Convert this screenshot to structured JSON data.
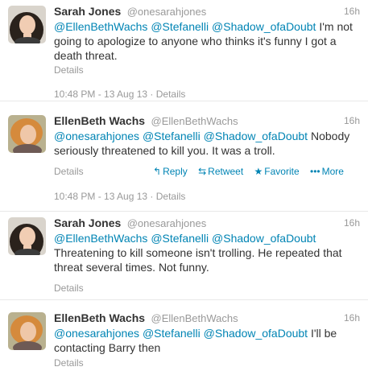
{
  "tweets": [
    {
      "fullname": "Sarah Jones",
      "handle": "@onesarahjones",
      "time": "16h",
      "mentions": [
        "@EllenBethWachs",
        "@Stefanelli",
        "@Shadow_ofaDoubt"
      ],
      "body": "I'm not going to apologize to anyone who thinks it's funny I got a death threat.",
      "details": "Details",
      "timestamp": "10:48 PM - 13 Aug 13 · Details"
    },
    {
      "fullname": "EllenBeth Wachs",
      "handle": "@EllenBethWachs",
      "time": "16h",
      "mentions": [
        "@onesarahjones",
        "@Stefanelli",
        "@Shadow_ofaDoubt"
      ],
      "body": "Nobody seriously threatened to kill you. It was a troll.",
      "details": "Details",
      "actions": {
        "reply": "Reply",
        "retweet": "Retweet",
        "favorite": "Favorite",
        "more": "More"
      },
      "timestamp": "10:48 PM - 13 Aug 13 · Details"
    },
    {
      "fullname": "Sarah Jones",
      "handle": "@onesarahjones",
      "time": "16h",
      "mentions": [
        "@EllenBethWachs",
        "@Stefanelli",
        "@Shadow_ofaDoubt"
      ],
      "body": "Threatening to kill someone isn't trolling. He repeated that threat several times. Not funny.",
      "details": "Details"
    },
    {
      "fullname": "EllenBeth Wachs",
      "handle": "@EllenBethWachs",
      "time": "16h",
      "mentions": [
        "@onesarahjones",
        "@Stefanelli",
        "@Shadow_ofaDoubt"
      ],
      "body": "I'll be contacting Barry then",
      "details": "Details"
    }
  ],
  "colors": {
    "link": "#0084b4",
    "muted": "#999999",
    "text": "#333333",
    "expanded_bg": "#f5f8fa"
  }
}
